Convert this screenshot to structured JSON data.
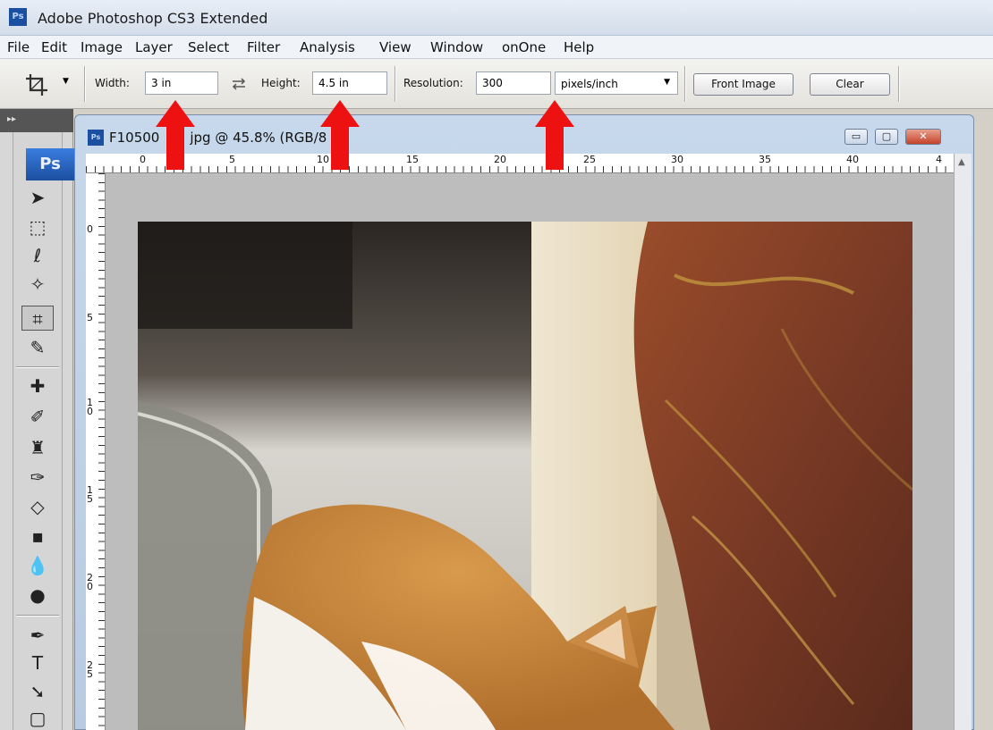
{
  "app": {
    "badge": "Ps",
    "title": "Adobe Photoshop CS3 Extended"
  },
  "menu": [
    "File",
    "Edit",
    "Image",
    "Layer",
    "Select",
    "Filter",
    "Analysis",
    "View",
    "Window",
    "onOne",
    "Help"
  ],
  "options": {
    "width_label": "Width:",
    "width_value": "3 in",
    "swap_icon": "swap-arrows-icon",
    "height_label": "Height:",
    "height_value": "4.5 in",
    "resolution_label": "Resolution:",
    "resolution_value": "300",
    "unit_selected": "pixels/inch",
    "front_image_label": "Front Image",
    "clear_label": "Clear"
  },
  "toolbox": {
    "header": "▸▸",
    "ps_badge": "Ps"
  },
  "document": {
    "icon_badge": "Ps",
    "title": "F10500",
    "title_rest": "jpg @ 45.8% (RGB/8",
    "min_label": "▭",
    "max_label": "▢",
    "close_label": "✕"
  },
  "rulers": {
    "horizontal": [
      "0",
      "5",
      "10",
      "15",
      "20",
      "25",
      "30",
      "35",
      "40",
      "4"
    ],
    "vertical": [
      "0",
      "5",
      "10",
      "15",
      "20",
      "25"
    ]
  },
  "colors": {
    "arrow": "#ee1111",
    "ps_blue": "#1b4fa0"
  }
}
